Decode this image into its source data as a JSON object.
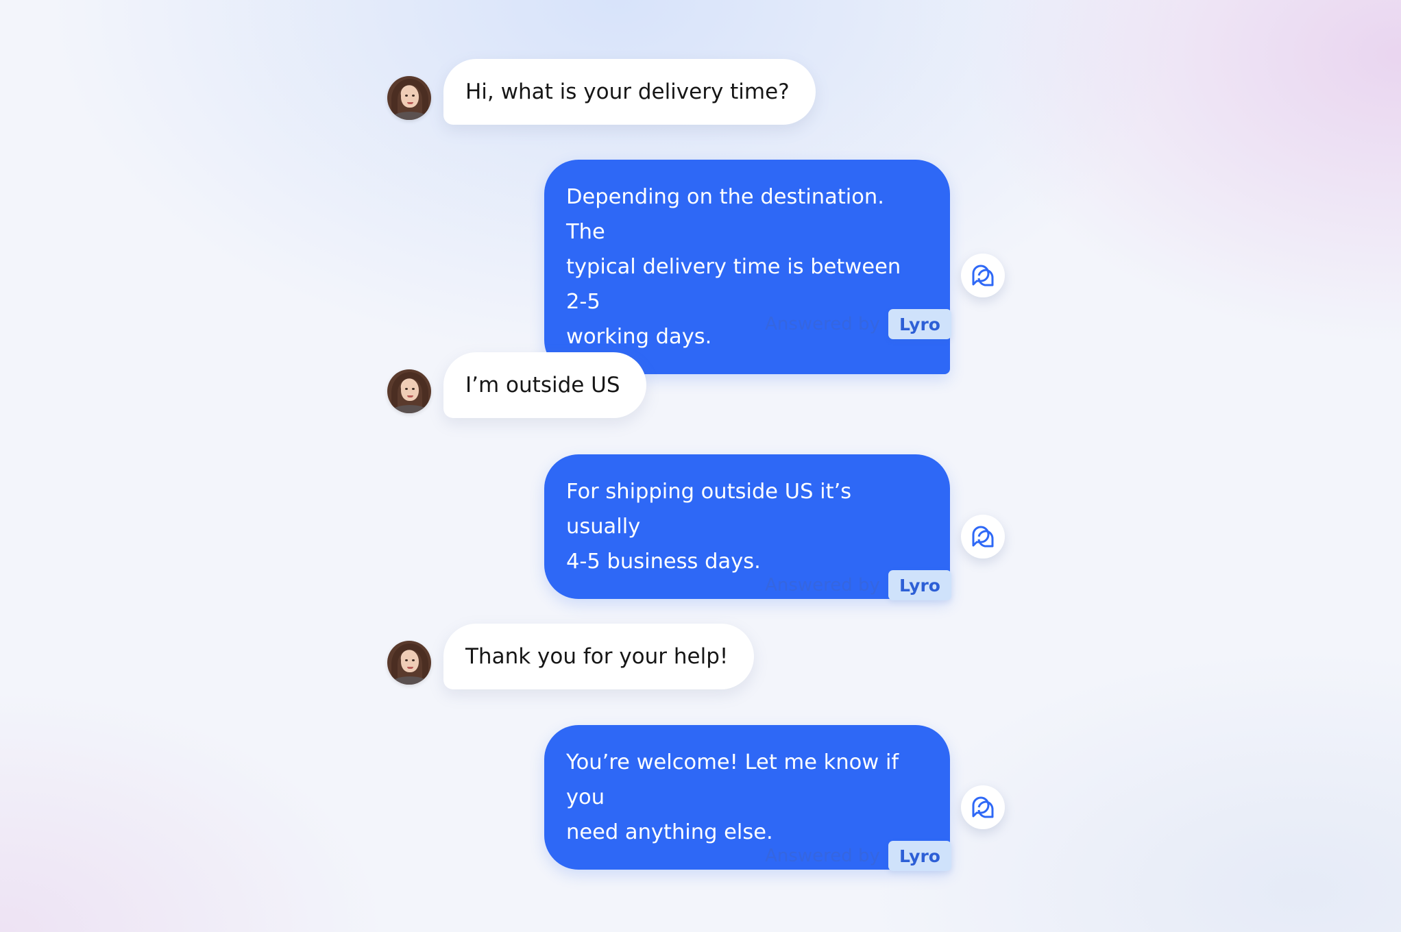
{
  "colors": {
    "bot_bubble": "#2e68f6",
    "user_bubble": "#ffffff",
    "accent_text": "#3566e0",
    "badge_bg": "#cfe2fb"
  },
  "conversation": {
    "messages": [
      {
        "from": "customer",
        "avatar_icon": "customer-avatar",
        "text": "Hi, what is your delivery time?"
      },
      {
        "from": "bot",
        "bot_icon": "lyro-icon",
        "lines": [
          "Depending on the destination. The",
          "typical delivery time is between 2-5",
          "working days."
        ],
        "answered_by": "Answered by",
        "badge": "Lyro"
      },
      {
        "from": "customer",
        "avatar_icon": "customer-avatar",
        "text": "I’m outside US"
      },
      {
        "from": "bot",
        "bot_icon": "lyro-icon",
        "lines": [
          "For shipping outside US it’s usually",
          "4-5 business days."
        ],
        "answered_by": "Answered by",
        "badge": "Lyro"
      },
      {
        "from": "customer",
        "avatar_icon": "customer-avatar",
        "text": "Thank you for your help!"
      },
      {
        "from": "bot",
        "bot_icon": "lyro-icon",
        "lines": [
          "You’re welcome! Let me know if you",
          "need anything else."
        ],
        "answered_by": "Answered by",
        "badge": "Lyro"
      }
    ]
  }
}
